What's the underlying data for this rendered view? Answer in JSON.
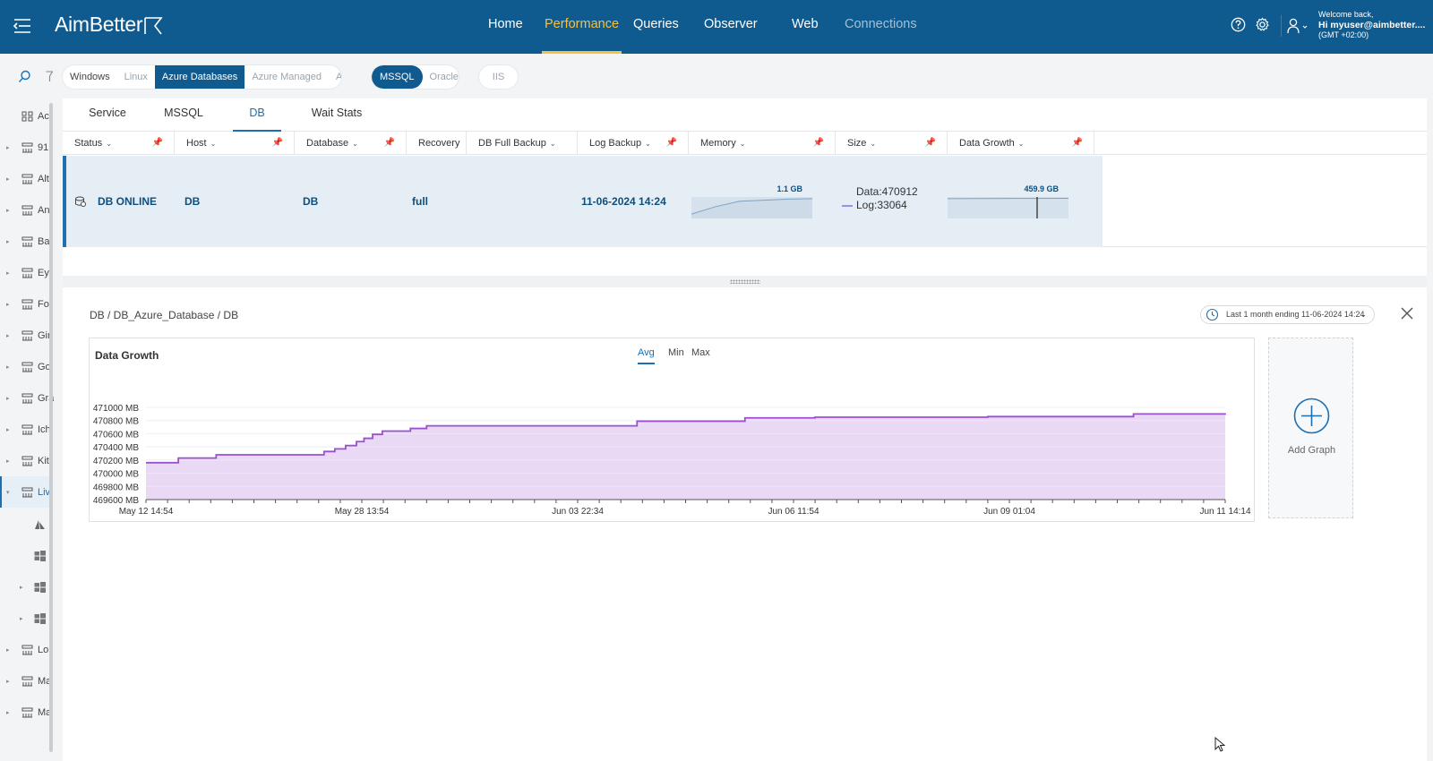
{
  "header": {
    "logo": "AimBetter",
    "nav": [
      {
        "label": "Home",
        "state": "normal"
      },
      {
        "label": "Performance",
        "state": "active"
      },
      {
        "label": "Queries",
        "state": "normal"
      },
      {
        "label": "Observer",
        "state": "normal"
      },
      {
        "label": "Web",
        "state": "normal"
      },
      {
        "label": "Connections",
        "state": "dim"
      }
    ],
    "welcome": "Welcome back,",
    "user": "Hi myuser@aimbetter....",
    "timezone": "(GMT +02:00)"
  },
  "sidebar": {
    "items": [
      {
        "label": "Ac",
        "icon": "grid-icon"
      },
      {
        "label": "91",
        "icon": "server-icon"
      },
      {
        "label": "Alt",
        "icon": "server-icon"
      },
      {
        "label": "An",
        "icon": "server-icon"
      },
      {
        "label": "Ba",
        "icon": "server-icon"
      },
      {
        "label": "Eyi",
        "icon": "server-icon"
      },
      {
        "label": "Fo:",
        "icon": "server-icon"
      },
      {
        "label": "Gir",
        "icon": "server-icon"
      },
      {
        "label": "Go",
        "icon": "server-icon"
      },
      {
        "label": "Gra",
        "icon": "server-icon"
      },
      {
        "label": "Ich",
        "icon": "server-icon"
      },
      {
        "label": "Kit",
        "icon": "server-icon"
      },
      {
        "label": "Liv",
        "icon": "server-icon"
      },
      {
        "label": "",
        "icon": "azure-icon"
      },
      {
        "label": "",
        "icon": "windows-icon"
      },
      {
        "label": "",
        "icon": "windows-icon"
      },
      {
        "label": "",
        "icon": "windows-icon"
      },
      {
        "label": "Lor",
        "icon": "server-icon"
      },
      {
        "label": "Ma",
        "icon": "server-icon"
      },
      {
        "label": "Ma",
        "icon": "server-icon"
      }
    ]
  },
  "filters": {
    "platforms": [
      "Windows",
      "Linux",
      "Azure Databases",
      "Azure Managed",
      "AWS"
    ],
    "platform_selected": "Azure Databases",
    "engines": [
      "MSSQL",
      "Oracle"
    ],
    "engine_selected": "MSSQL",
    "extra": "IIS"
  },
  "tabs": [
    "Service",
    "MSSQL",
    "DB",
    "Wait Stats"
  ],
  "tab_selected": "DB",
  "table": {
    "columns": [
      "Status",
      "Host",
      "Database",
      "Recovery",
      "DB Full Backup",
      "Log Backup",
      "Memory",
      "Size",
      "Data Growth"
    ],
    "row": {
      "status": "DB ONLINE",
      "host": "DB",
      "database": "DB",
      "recovery": "full",
      "db_full_backup": "",
      "log_backup": "11-06-2024 14:24",
      "memory": "1.1 GB",
      "size_data": "Data:470912",
      "size_log": "Log:33064",
      "data_growth": "459.9 GB"
    }
  },
  "detail": {
    "breadcrumb": "DB / DB_Azure_Database / DB",
    "range": "Last 1 month ending  11-06-2024 14:24",
    "add_graph": "Add Graph"
  },
  "chart_data": {
    "type": "area",
    "title": "Data Growth",
    "aggregations": [
      "Avg",
      "Min",
      "Max"
    ],
    "aggregation_selected": "Avg",
    "color": "#9b4fd1",
    "fill": "#ead9f5",
    "ylim": [
      469600,
      471000
    ],
    "y_ticks": [
      471000,
      470800,
      470600,
      470400,
      470200,
      470000,
      469800,
      469600
    ],
    "y_tick_labels": [
      "471000 MB",
      "470800 MB",
      "470600 MB",
      "470400 MB",
      "470200 MB",
      "470000 MB",
      "469800 MB",
      "469600 MB"
    ],
    "x_range": [
      0,
      100
    ],
    "x_ticks": [
      0,
      20,
      40,
      60,
      80,
      100
    ],
    "x_tick_labels": [
      "May 12 14:54",
      "May 28 13:54",
      "Jun 03 22:34",
      "Jun 06 11:54",
      "Jun 09 01:04",
      "Jun 11 14:14"
    ],
    "series": [
      {
        "x": [
          0,
          3,
          6.5,
          16.5,
          17.5,
          18.5,
          19.5,
          20.2,
          21,
          21.9,
          24.5,
          26,
          45.5,
          55.5,
          62,
          78,
          91.5,
          100
        ],
        "y": [
          470160,
          470230,
          470280,
          470330,
          470370,
          470420,
          470480,
          470530,
          470590,
          470640,
          470680,
          470720,
          470790,
          470840,
          470850,
          470860,
          470900,
          470910
        ]
      }
    ]
  },
  "memory_spark": [
    0.2,
    0.55,
    0.8,
    0.85,
    0.9,
    0.92
  ],
  "growth_spark": [
    0.92,
    0.93,
    0.94
  ]
}
